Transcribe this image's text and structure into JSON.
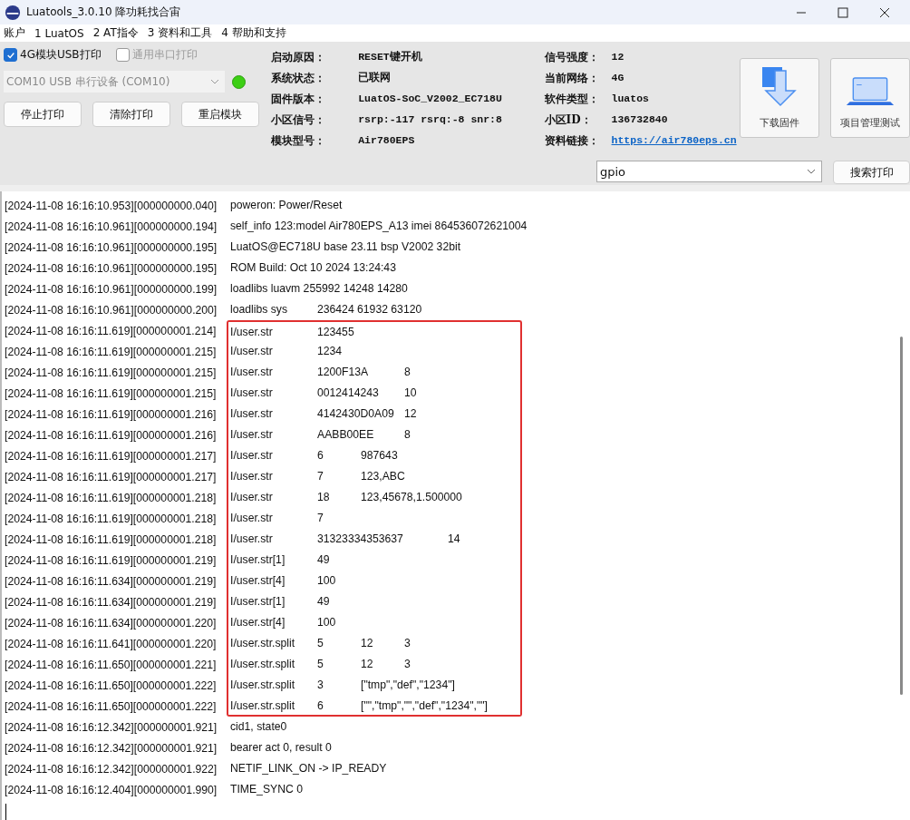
{
  "window": {
    "title": "Luatools_3.0.10 降功耗找合宙"
  },
  "menu": [
    "账户",
    "1 LuatOS",
    "2 AT指令",
    "3 资料和工具",
    "4 帮助和支持"
  ],
  "print_options": [
    {
      "label": "4G模块USB打印",
      "checked": true,
      "disabled": false
    },
    {
      "label": "通用串口打印",
      "checked": false,
      "disabled": true
    }
  ],
  "port_select": {
    "value": "COM10 USB 串行设备 (COM10)",
    "disabled": true
  },
  "connected": true,
  "actions": [
    "停止打印",
    "清除打印",
    "重启模块"
  ],
  "info_left": [
    {
      "label": "启动原因：",
      "value": "RESET键开机"
    },
    {
      "label": "系统状态：",
      "value": "已联网"
    },
    {
      "label": "固件版本：",
      "value": "LuatOS-SoC_V2002_EC718U"
    },
    {
      "label": "小区信号：",
      "value": "rsrp:-117 rsrq:-8 snr:8"
    },
    {
      "label": "模块型号：",
      "value": "Air780EPS"
    }
  ],
  "info_right": [
    {
      "label": "信号强度：",
      "value": "12",
      "kind": "text"
    },
    {
      "label": "当前网络：",
      "value": "4G",
      "kind": "text"
    },
    {
      "label": "软件类型：",
      "value": "luatos",
      "kind": "text"
    },
    {
      "label": "小区ID：",
      "value": "136732840",
      "kind": "text"
    },
    {
      "label": "资料链接：",
      "value": "https://air780eps.cn",
      "kind": "link"
    }
  ],
  "tool_buttons": [
    {
      "label": "下载固件",
      "kind": "download"
    },
    {
      "label": "项目管理测试",
      "kind": "laptop"
    }
  ],
  "search": {
    "value": "gpio",
    "button": "搜索打印"
  },
  "log": [
    {
      "prefix": "[2024-11-08 16:16:10.953][000000000.040]",
      "message": "poweron: Power/Reset",
      "highlighted": false
    },
    {
      "prefix": "[2024-11-08 16:16:10.961][000000000.194]",
      "message": "self_info 123:model Air780EPS_A13 imei 864536072621004",
      "highlighted": false
    },
    {
      "prefix": "[2024-11-08 16:16:10.961][000000000.195]",
      "message": "LuatOS@EC718U base 23.11 bsp V2002 32bit",
      "highlighted": false
    },
    {
      "prefix": "[2024-11-08 16:16:10.961][000000000.195]",
      "message": "ROM Build: Oct 10 2024 13:24:43",
      "highlighted": false
    },
    {
      "prefix": "[2024-11-08 16:16:10.961][000000000.199]",
      "message": "loadlibs luavm 255992 14248 14280",
      "highlighted": false
    },
    {
      "prefix": "[2024-11-08 16:16:10.961][000000000.200]",
      "message": "loadlibs sys\t236424 61932 63120",
      "highlighted": false
    },
    {
      "prefix": "[2024-11-08 16:16:11.619][000000001.214]",
      "message": "I/user.str\t123455",
      "highlighted": true
    },
    {
      "prefix": "[2024-11-08 16:16:11.619][000000001.215]",
      "message": "I/user.str\t1234",
      "highlighted": true
    },
    {
      "prefix": "[2024-11-08 16:16:11.619][000000001.215]",
      "message": "I/user.str\t1200F13A\t8",
      "highlighted": true
    },
    {
      "prefix": "[2024-11-08 16:16:11.619][000000001.215]",
      "message": "I/user.str\t0012414243\t10",
      "highlighted": true
    },
    {
      "prefix": "[2024-11-08 16:16:11.619][000000001.216]",
      "message": "I/user.str\t4142430D0A09\t12",
      "highlighted": true
    },
    {
      "prefix": "[2024-11-08 16:16:11.619][000000001.216]",
      "message": "I/user.str\tAABB00EE\t8",
      "highlighted": true
    },
    {
      "prefix": "[2024-11-08 16:16:11.619][000000001.217]",
      "message": "I/user.str\t6\t987643",
      "highlighted": true
    },
    {
      "prefix": "[2024-11-08 16:16:11.619][000000001.217]",
      "message": "I/user.str\t7\t123,ABC",
      "highlighted": true
    },
    {
      "prefix": "[2024-11-08 16:16:11.619][000000001.218]",
      "message": "I/user.str\t18\t123,45678,1.500000",
      "highlighted": true
    },
    {
      "prefix": "[2024-11-08 16:16:11.619][000000001.218]",
      "message": "I/user.str\t7",
      "highlighted": true
    },
    {
      "prefix": "[2024-11-08 16:16:11.619][000000001.218]",
      "message": "I/user.str\t31323334353637\t14",
      "highlighted": true
    },
    {
      "prefix": "[2024-11-08 16:16:11.619][000000001.219]",
      "message": "I/user.str[1]\t49",
      "highlighted": true
    },
    {
      "prefix": "[2024-11-08 16:16:11.634][000000001.219]",
      "message": "I/user.str[4]\t100",
      "highlighted": true
    },
    {
      "prefix": "[2024-11-08 16:16:11.634][000000001.219]",
      "message": "I/user.str[1]\t49",
      "highlighted": true
    },
    {
      "prefix": "[2024-11-08 16:16:11.634][000000001.220]",
      "message": "I/user.str[4]\t100",
      "highlighted": true
    },
    {
      "prefix": "[2024-11-08 16:16:11.641][000000001.220]",
      "message": "I/user.str.split\t5\t12\t3",
      "highlighted": true
    },
    {
      "prefix": "[2024-11-08 16:16:11.650][000000001.221]",
      "message": "I/user.str.split\t5\t12\t3",
      "highlighted": true
    },
    {
      "prefix": "[2024-11-08 16:16:11.650][000000001.222]",
      "message": "I/user.str.split\t3\t[\"tmp\",\"def\",\"1234\"]",
      "highlighted": true
    },
    {
      "prefix": "[2024-11-08 16:16:11.650][000000001.222]",
      "message": "I/user.str.split\t6\t[\"\",\"tmp\",\"\",\"def\",\"1234\",\"\"]",
      "highlighted": true
    },
    {
      "prefix": "[2024-11-08 16:16:12.342][000000001.921]",
      "message": "cid1, state0",
      "highlighted": false
    },
    {
      "prefix": "[2024-11-08 16:16:12.342][000000001.921]",
      "message": "bearer act 0, result 0",
      "highlighted": false
    },
    {
      "prefix": "[2024-11-08 16:16:12.342][000000001.922]",
      "message": "NETIF_LINK_ON -> IP_READY",
      "highlighted": false
    },
    {
      "prefix": "[2024-11-08 16:16:12.404][000000001.990]",
      "message": "TIME_SYNC 0",
      "highlighted": false
    }
  ]
}
